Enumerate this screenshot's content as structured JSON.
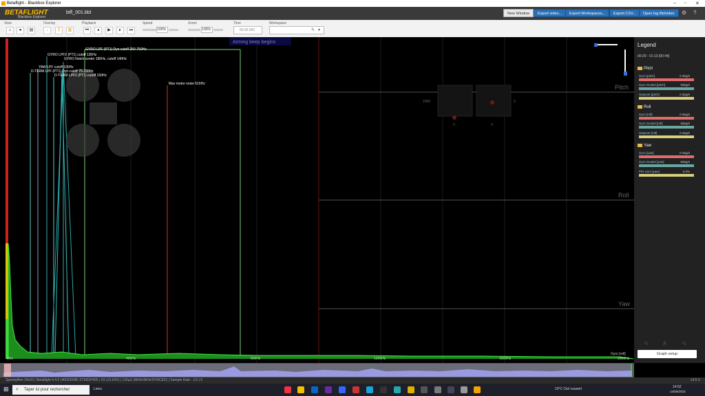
{
  "window": {
    "title": "Betaflight - Blackbox Explorer",
    "min": "–",
    "max": "▫",
    "close": "✕"
  },
  "header": {
    "logo": "BETAFLIGHT",
    "logo_sub": "Blackbox Explorer",
    "file_name": "btfl_001.bbl",
    "buttons": [
      "New Window",
      "Export video...",
      "Export Workspaces...",
      "Export CSV...",
      "Open log file/video"
    ],
    "gear": "⚙",
    "help": "?"
  },
  "toolbar": {
    "view_label": "View",
    "overlay_label": "Overlay",
    "playback_label": "Playback",
    "speed_label": "Speed",
    "zoom_label": "Zoom",
    "time_label": "Time",
    "workspace_label": "Workspace",
    "speed_value": "100%",
    "zoom_value": "100%",
    "time_value": "00:00.000"
  },
  "graph": {
    "top_banner": "Arming beep begins",
    "filter_labels": [
      "GYRO LPF (PT1) Dyn cutoff 250-750Hz",
      "GYRO LPF2 (PT1) cutoff 130Hz",
      "GYRO Notch center 180Hz, cutoff 140Hz",
      "YAW LPF cutoff 100Hz",
      "D-TERM LPF (PT1) Dyn cutoff 75-150Hz",
      "D-TERM LPF2 (PT1) cutoff 150Hz",
      "Max motor noise 516Hz"
    ],
    "x_ticks": [
      "0Hz",
      "400Hz",
      "800Hz",
      "1200Hz",
      "1600Hz",
      "2000Hz"
    ],
    "axis_labels": [
      "Pitch",
      "Roll",
      "Yaw"
    ],
    "stick_value": "1000",
    "stick_zero_a": "0",
    "stick_zero_b": "0",
    "stick_zero_c": "0",
    "series_label": "Gyro [roll]"
  },
  "legend": {
    "title": "Legend",
    "time_range": "00:29 - 01:13 [00:44]",
    "groups": [
      {
        "name": "Pitch",
        "items": [
          {
            "label": "Gyro [pitch]",
            "value": "0 deg/s",
            "color": "#e06c6c"
          },
          {
            "label": "Gyro Scaled [pitch]",
            "value": "0deg/s",
            "color": "#6aa7a3"
          },
          {
            "label": "Setpoint [pitch]",
            "value": "0 deg/s",
            "color": "#d8cf7a"
          }
        ]
      },
      {
        "name": "Roll",
        "items": [
          {
            "label": "Gyro [roll]",
            "value": "0 deg/s",
            "color": "#e06c6c"
          },
          {
            "label": "Gyro Scaled [roll]",
            "value": "0deg/s",
            "color": "#6aa7a3"
          },
          {
            "label": "Setpoint [roll]",
            "value": "0 deg/s",
            "color": "#d8cf7a"
          }
        ]
      },
      {
        "name": "Yaw",
        "items": [
          {
            "label": "Gyro [yaw]",
            "value": "0 deg/s",
            "color": "#e06c6c"
          },
          {
            "label": "Gyro Scaled [yaw]",
            "value": "0deg/s",
            "color": "#6aa7a3"
          },
          {
            "label": "PID Sum [yaw]",
            "value": "0.0%",
            "color": "#d8cf7a"
          }
        ]
      }
    ],
    "graph_setup": "Graph setup"
  },
  "status": {
    "text": "SpeedyBee 20x20 | Betaflight 4.4.0 (4605309B) STM32F405 | 6S (23.63V) | 125µS (8kHz/4kHz/SYNCED) | Sample Rate : 1/1 | 0",
    "version": "v3.6.0"
  },
  "taskbar": {
    "search": "Taper ici pour rechercher",
    "liens": "Liens",
    "weather": "23°C  Ciel couvert",
    "time": "14:52",
    "date": "14/06/2023"
  }
}
